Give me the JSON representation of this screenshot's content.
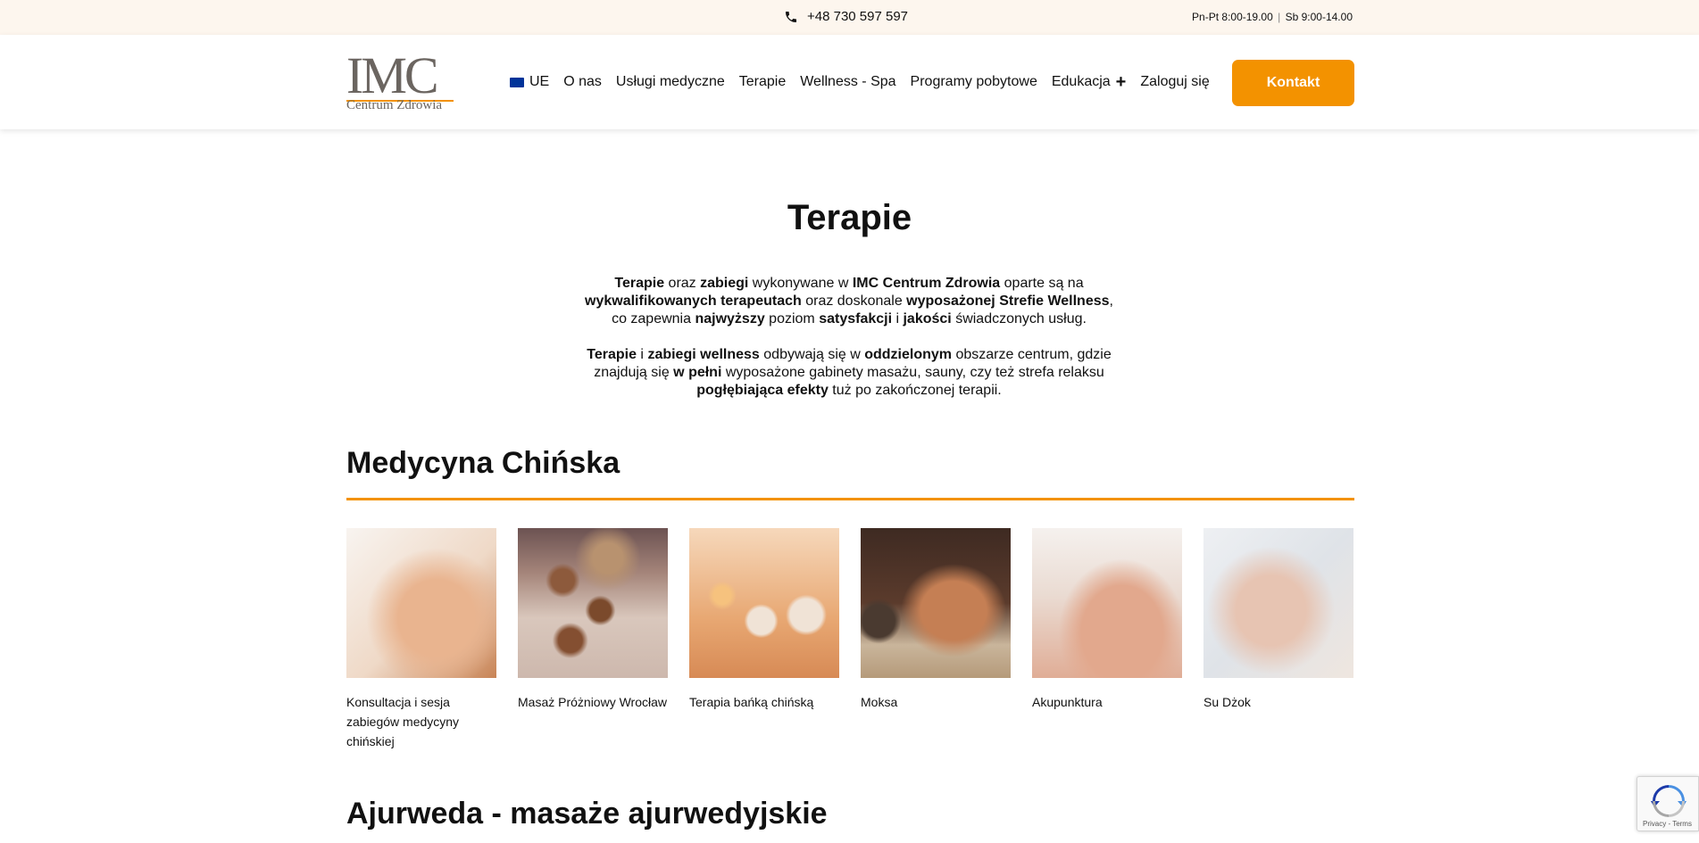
{
  "topbar": {
    "phone": "+48 730 597 597",
    "hours_weekdays": "Pn-Pt 8:00-19.00",
    "hours_sep": "|",
    "hours_saturday": "Sb 9:00-14.00"
  },
  "header": {
    "logo_mark": "IMC",
    "logo_sub": "Centrum Zdrowia",
    "nav": {
      "ue": "UE",
      "o_nas": "O nas",
      "uslugi": "Usługi medyczne",
      "terapie": "Terapie",
      "wellness": "Wellness - Spa",
      "programy": "Programy pobytowe",
      "edukacja": "Edukacja",
      "edukacja_toggle": "+",
      "zaloguj": "Zaloguj się"
    },
    "contact_button": "Kontakt"
  },
  "main": {
    "title": "Terapie",
    "intro_p1": [
      "Terapie",
      " oraz ",
      "zabiegi",
      " wykonywane w ",
      "IMC Centrum Zdrowia",
      " oparte są na ",
      "wykwalifikowanych terapeutach",
      " oraz doskonale ",
      "wyposażonej Strefie Wellness",
      ", co zapewnia ",
      "najwyższy",
      " poziom ",
      "satysfakcji",
      " i ",
      "jakości",
      " świadczonych usług."
    ],
    "intro_p2": [
      "Terapie",
      " i ",
      "zabiegi wellness",
      " odbywają się w ",
      "oddzielonym",
      " obszarze centrum, gdzie znajdują się ",
      "w pełni",
      " wyposażone gabinety masażu, sauny, czy też strefa relaksu ",
      "pogłębiająca efekty",
      " tuż po zakończonej terapii."
    ],
    "section1": {
      "title": "Medycyna Chińska",
      "items": [
        {
          "label": "Konsultacja i sesja zabiegów medycyny chińskiej"
        },
        {
          "label": "Masaż Próżniowy Wrocław"
        },
        {
          "label": "Terapia bańką chińską"
        },
        {
          "label": "Moksa"
        },
        {
          "label": "Akupunktura"
        },
        {
          "label": "Su Dżok"
        }
      ]
    },
    "section2": {
      "title": "Ajurweda - masaże ajurwedyjskie"
    }
  },
  "recaptcha": {
    "text": "Privacy - Terms"
  },
  "colors": {
    "accent": "#f39200",
    "topbar_bg": "#fdf6ee",
    "logo_gray": "#6b6560"
  }
}
